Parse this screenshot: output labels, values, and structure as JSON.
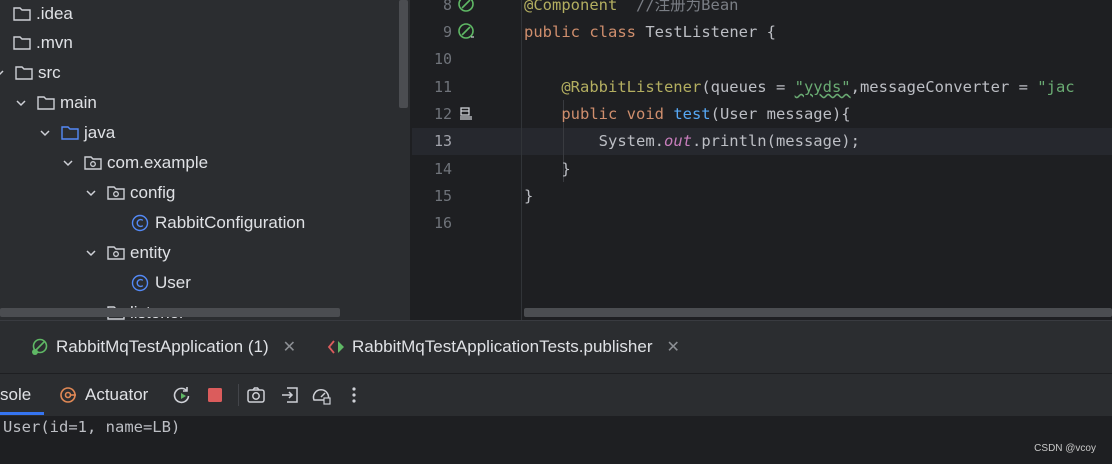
{
  "project_tree": [
    {
      "label": ".idea",
      "kind": "folder",
      "expanded": false,
      "indent": 0
    },
    {
      "label": ".mvn",
      "kind": "folder",
      "expanded": false,
      "indent": 0
    },
    {
      "label": "src",
      "kind": "folder",
      "expanded": true,
      "indent": 0
    },
    {
      "label": "main",
      "kind": "folder",
      "expanded": true,
      "indent": 1
    },
    {
      "label": "java",
      "kind": "source-folder",
      "expanded": true,
      "indent": 2
    },
    {
      "label": "com.example",
      "kind": "package",
      "expanded": true,
      "indent": 3
    },
    {
      "label": "config",
      "kind": "package",
      "expanded": true,
      "indent": 4
    },
    {
      "label": "RabbitConfiguration",
      "kind": "class",
      "indent": 5
    },
    {
      "label": "entity",
      "kind": "package",
      "expanded": true,
      "indent": 4
    },
    {
      "label": "User",
      "kind": "class",
      "indent": 5
    },
    {
      "label": "listener",
      "kind": "package",
      "expanded": true,
      "indent": 4
    }
  ],
  "editor": {
    "line_numbers": [
      "8",
      "9",
      "10",
      "11",
      "12",
      "13",
      "14",
      "15",
      "16"
    ],
    "current_line": "13",
    "code": {
      "l8_annotation": "@Component",
      "l8_comment": "  //注册为Bean",
      "l9_kw": "public class ",
      "l9_name": "TestListener {",
      "l11_annotation": "    @RabbitListener",
      "l11_rest": "(queues = ",
      "l11_str": "\"yyds\"",
      "l11_rest2": ",messageConverter = ",
      "l11_str2": "\"jac",
      "l12_kw": "    public void ",
      "l12_method": "test",
      "l12_rest": "(User message){",
      "l13_a": "        System.",
      "l13_field": "out",
      "l13_b": ".println(message);",
      "l14": "    }",
      "l15": "}"
    }
  },
  "run_tabs": [
    {
      "label": "RabbitMqTestApplication (1)",
      "icon": "spring-run-icon"
    },
    {
      "label": "RabbitMqTestApplicationTests.publisher",
      "icon": "test-run-icon"
    }
  ],
  "toolbar": {
    "console_label": "sole",
    "actuator_label": "Actuator",
    "buttons": [
      "rerun-icon",
      "stop-icon",
      "camera-icon",
      "exit-icon",
      "dashboard-icon",
      "more-icon"
    ]
  },
  "console_output": "User(id=1, name=LB)",
  "watermark": "CSDN @vcoy",
  "colors": {
    "accent": "#3574f0",
    "keyword": "#cf8e6d",
    "annotation": "#b3ae60",
    "string": "#6aab73",
    "method": "#56a8f5",
    "static_field": "#c77dbb",
    "comment": "#7a7e85",
    "stop": "#db5c5c",
    "spring": "#5fb865"
  }
}
